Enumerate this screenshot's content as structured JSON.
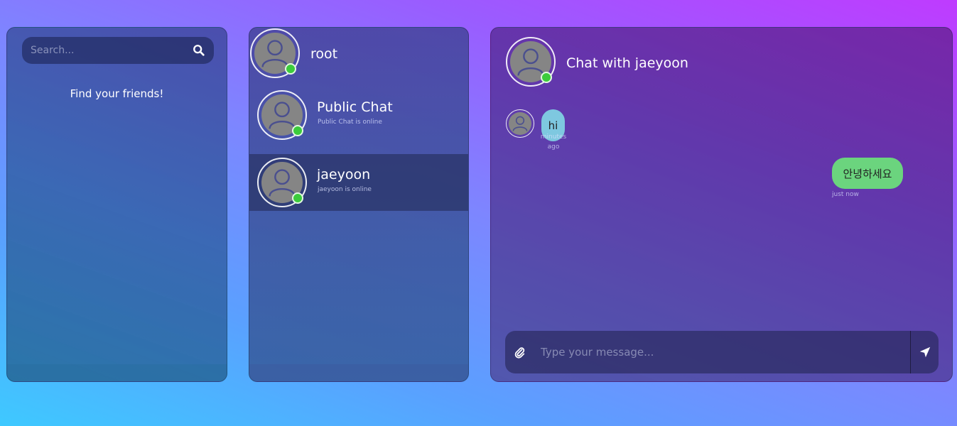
{
  "search": {
    "placeholder": "Search..."
  },
  "left": {
    "find_text": "Find your friends!"
  },
  "me": {
    "name": "root"
  },
  "contacts": [
    {
      "name": "Public Chat",
      "status": "Public Chat is online"
    },
    {
      "name": "jaeyoon",
      "status": "jaeyoon is online"
    }
  ],
  "chat": {
    "title": "Chat with jaeyoon",
    "messages": [
      {
        "text": "hi",
        "time": "minutes ago",
        "direction": "incoming"
      },
      {
        "text": "안녕하세요",
        "time": "just now",
        "direction": "outgoing"
      }
    ],
    "input_placeholder": "Type your message..."
  },
  "colors": {
    "online": "#3ccc3c",
    "incoming_bubble": "#7ec8e0",
    "outgoing_bubble": "#6bd47e"
  },
  "icons": {
    "search": "search-icon",
    "avatar": "user-icon",
    "attach": "paperclip-icon",
    "send": "paper-plane-icon"
  }
}
